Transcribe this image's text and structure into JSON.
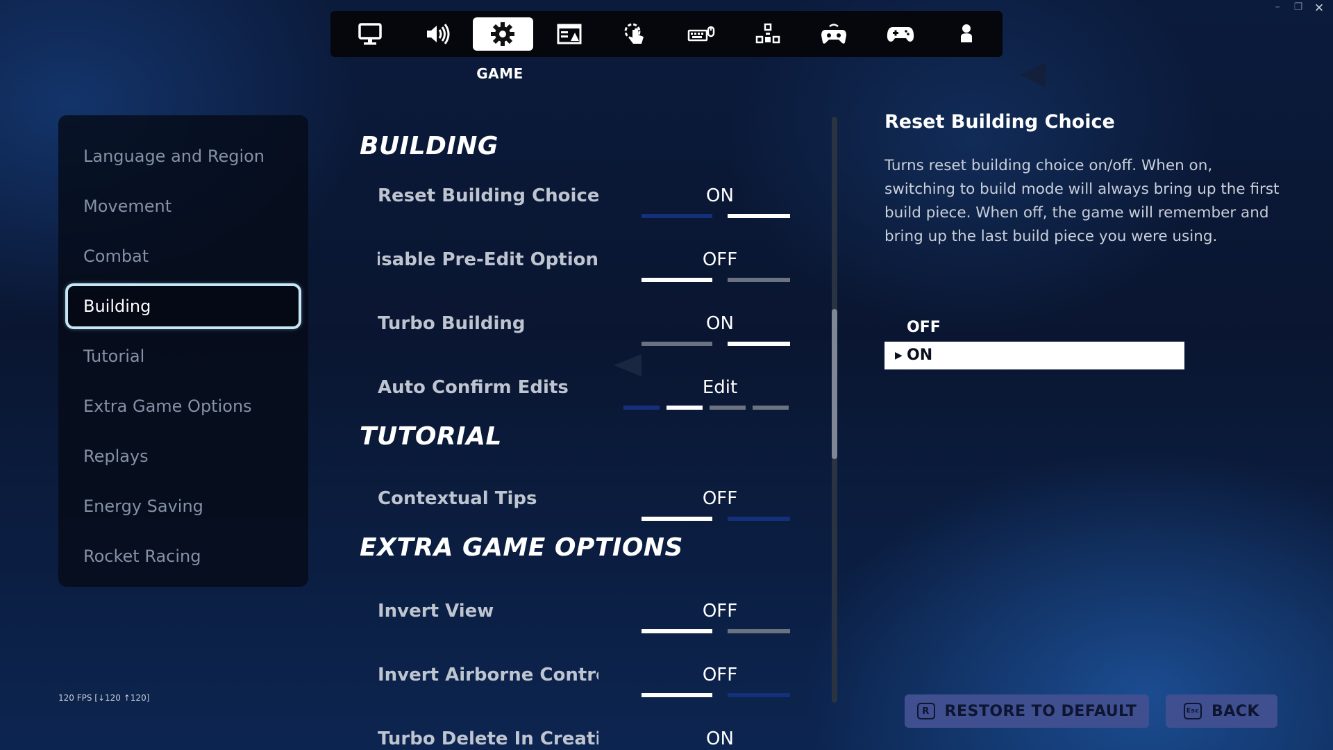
{
  "window": {
    "controls": {
      "minimize": "–",
      "restore": "❐",
      "close": "✕"
    }
  },
  "tabs": [
    {
      "name": "display-tab",
      "icon": "monitor-icon"
    },
    {
      "name": "audio-tab",
      "icon": "speaker-icon"
    },
    {
      "name": "game-tab",
      "icon": "gear-icon",
      "active": true
    },
    {
      "name": "accessibility-tab",
      "icon": "accessibility-icon"
    },
    {
      "name": "touch-tab",
      "icon": "touch-icon"
    },
    {
      "name": "keyboard-mouse-tab",
      "icon": "keyboard-mouse-icon"
    },
    {
      "name": "controller-layout-tab",
      "icon": "controller-layout-icon"
    },
    {
      "name": "wireless-controller-tab",
      "icon": "wireless-controller-icon"
    },
    {
      "name": "controller-tab",
      "icon": "gamepad-icon"
    },
    {
      "name": "account-tab",
      "icon": "person-icon"
    }
  ],
  "active_tab_caption": "GAME",
  "sidebar": {
    "items": [
      {
        "label": "Language and Region"
      },
      {
        "label": "Movement"
      },
      {
        "label": "Combat"
      },
      {
        "label": "Building",
        "active": true
      },
      {
        "label": "Tutorial"
      },
      {
        "label": "Extra Game Options"
      },
      {
        "label": "Replays"
      },
      {
        "label": "Energy Saving"
      },
      {
        "label": "Rocket Racing"
      }
    ]
  },
  "fps": "120 FPS [↓120 ↑120]",
  "settings": {
    "building": {
      "title": "BUILDING",
      "rows": [
        {
          "label": "Reset Building Choice",
          "value": "ON",
          "bars": [
            "blue",
            "white"
          ]
        },
        {
          "label": "Disable Pre-Edit Option",
          "value": "OFF",
          "bars": [
            "white",
            "gray"
          ]
        },
        {
          "label": "Turbo Building",
          "value": "ON",
          "bars": [
            "gray",
            "white"
          ]
        },
        {
          "label": "Auto Confirm Edits",
          "value": "Edit",
          "bars": [
            "blue",
            "white",
            "gray",
            "gray"
          ]
        }
      ]
    },
    "tutorial": {
      "title": "TUTORIAL",
      "rows": [
        {
          "label": "Contextual Tips",
          "value": "OFF",
          "bars": [
            "white",
            "blue"
          ]
        }
      ]
    },
    "extra": {
      "title": "EXTRA GAME OPTIONS",
      "rows": [
        {
          "label": "Invert View",
          "value": "OFF",
          "bars": [
            "white",
            "gray"
          ]
        },
        {
          "label": "Invert Airborne Controls",
          "value": "OFF",
          "bars": [
            "white",
            "blue"
          ]
        },
        {
          "label": "Turbo Delete In Creative",
          "value": "ON",
          "bars": []
        }
      ]
    }
  },
  "description": {
    "title": "Reset Building Choice",
    "body": "Turns reset building choice on/off. When on, switching to build mode will always bring up the first build piece. When off, the game will remember and bring up the last build piece you were using.",
    "options": [
      {
        "label": "OFF"
      },
      {
        "label": "ON",
        "selected": true
      }
    ]
  },
  "buttons": {
    "restore": {
      "key": "R",
      "label": "RESTORE TO DEFAULT"
    },
    "back": {
      "key": "Esc",
      "label": "BACK"
    }
  },
  "colors": {
    "accent_blue": "#14307a",
    "button_bg": "#3f4f8f",
    "active_border": "#c7e6f6"
  }
}
